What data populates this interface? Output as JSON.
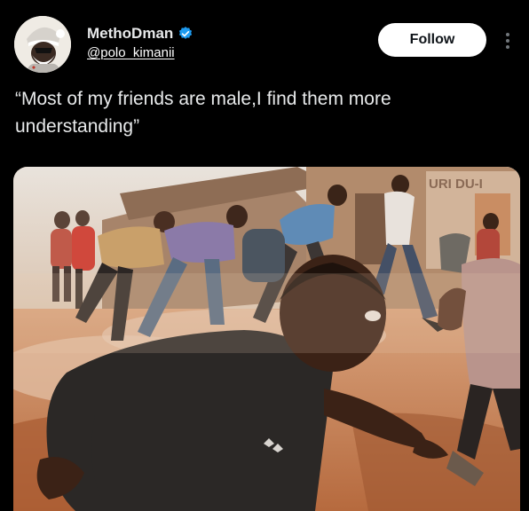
{
  "author": {
    "display_name": "MethoDman",
    "handle": "@polo_kimanii",
    "verified_icon": "verified-badge-icon",
    "avatar_icon": "avatar-santa-icon"
  },
  "actions": {
    "follow_label": "Follow",
    "more_icon": "more-vertical-icon"
  },
  "tweet": {
    "text": "“Most of my friends are male,I find them more understanding”"
  },
  "media": {
    "description_icon": "photo-running-crowd",
    "sign_text": "URI DU-I"
  },
  "colors": {
    "background": "#000000",
    "text": "#e7e9ea",
    "verified": "#1d9bf0",
    "follow_bg": "#ffffff"
  }
}
